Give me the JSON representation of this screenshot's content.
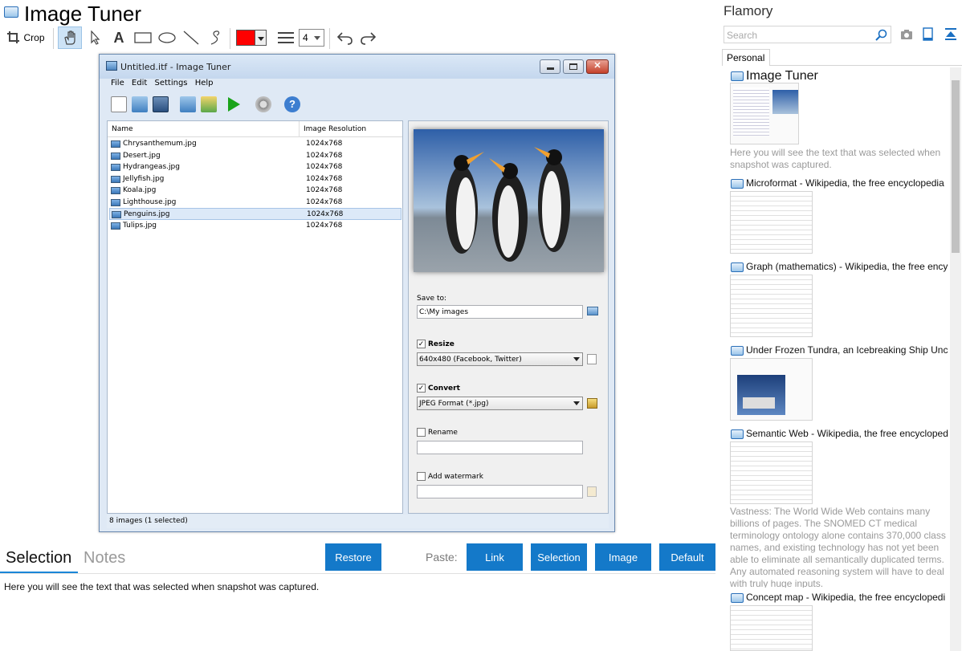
{
  "app": {
    "title": "Image Tuner"
  },
  "toolbar": {
    "crop_label": "Crop",
    "line_width": "4"
  },
  "screenshot": {
    "window_title": "Untitled.itf - Image Tuner",
    "menu": [
      "File",
      "Edit",
      "Settings",
      "Help"
    ],
    "columns": {
      "name": "Name",
      "resolution": "Image Resolution"
    },
    "files": [
      {
        "name": "Chrysanthemum.jpg",
        "res": "1024x768"
      },
      {
        "name": "Desert.jpg",
        "res": "1024x768"
      },
      {
        "name": "Hydrangeas.jpg",
        "res": "1024x768"
      },
      {
        "name": "Jellyfish.jpg",
        "res": "1024x768"
      },
      {
        "name": "Koala.jpg",
        "res": "1024x768"
      },
      {
        "name": "Lighthouse.jpg",
        "res": "1024x768"
      },
      {
        "name": "Penguins.jpg",
        "res": "1024x768"
      },
      {
        "name": "Tulips.jpg",
        "res": "1024x768"
      }
    ],
    "save_to_label": "Save to:",
    "save_to_value": "C:\\My images",
    "resize_label": "Resize",
    "resize_value": "640x480 (Facebook, Twitter)",
    "convert_label": "Convert",
    "convert_value": "JPEG Format (*.jpg)",
    "rename_label": "Rename",
    "watermark_label": "Add watermark",
    "status": "8 images (1 selected)"
  },
  "bottom": {
    "tab_selection": "Selection",
    "tab_notes": "Notes",
    "restore": "Restore",
    "paste_label": "Paste:",
    "paste_link": "Link",
    "paste_selection": "Selection",
    "paste_image": "Image",
    "paste_default": "Default",
    "selection_text": "Here you will see the text that was selected when snapshot was captured."
  },
  "flamory": {
    "title": "Flamory",
    "search_placeholder": "Search",
    "tab": "Personal",
    "snapshots": [
      {
        "title": "Image Tuner",
        "desc": "Here you will see the text that was selected when snapshot was captured."
      },
      {
        "title": "Microformat - Wikipedia, the free encyclopedia"
      },
      {
        "title": "Graph (mathematics) - Wikipedia, the free ency"
      },
      {
        "title": "Under Frozen Tundra, an Icebreaking Ship Unco"
      },
      {
        "title": "Semantic Web - Wikipedia, the free encycloped",
        "desc": "Vastness: The World Wide Web contains many billions of pages. The SNOMED CT medical terminology ontology alone contains 370,000 class names, and existing technology has not yet been able to eliminate all semantically duplicated terms. Any automated reasoning system will have to deal with truly huge inputs."
      },
      {
        "title": "Concept map - Wikipedia, the free encyclopedi"
      }
    ]
  }
}
